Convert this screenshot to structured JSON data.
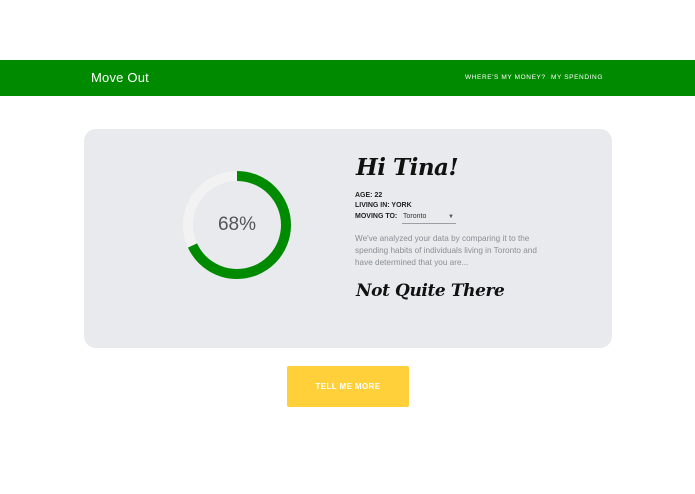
{
  "app": {
    "brand": "Move Out"
  },
  "nav": {
    "links": [
      "WHERE'S MY MONEY?",
      "MY SPENDING"
    ]
  },
  "profile": {
    "greeting": "Hi Tina!",
    "age_label": "AGE: 22",
    "living_label": "LIVING IN: YORK",
    "moving_label": "MOVING TO:",
    "moving_value": "Toronto",
    "description": "We've analyzed your data by comparing it to the spending habits of individuals living in Toronto and have determined that you are...",
    "verdict": "Not Quite There"
  },
  "score": {
    "value": 0.68,
    "label": "68%"
  },
  "cta": {
    "label": "TELL ME MORE"
  },
  "colors": {
    "brand_green": "#008a00",
    "ring_track": "#f2f2f2",
    "card_bg": "#e8eaed",
    "cta_yellow": "#ffd03a"
  }
}
